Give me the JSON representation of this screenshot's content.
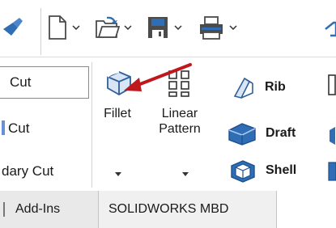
{
  "ribbon": {
    "cut_items": [
      "Cut",
      "Cut",
      "dary Cut"
    ],
    "fillet_label": "Fillet",
    "linear_pattern_label": "Linear\nPattern",
    "rib_label": "Rib",
    "draft_label": "Draft",
    "shell_label": "Shell"
  },
  "tabs": [
    {
      "label": "Add-Ins"
    },
    {
      "label": "SOLIDWORKS MBD"
    }
  ],
  "colors": {
    "annotation_arrow": "#c0171c",
    "ribbon_separator": "#d4d4d4",
    "tab_bg": "#e9e9e9",
    "icon_blue": "#2f6db5"
  }
}
